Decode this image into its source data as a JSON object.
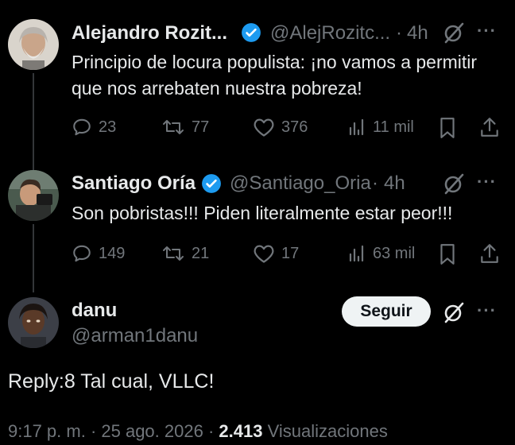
{
  "tweets": [
    {
      "name": "Alejandro Rozit...",
      "handle": "@AlejRozitc...",
      "time": "4h",
      "text": "Principio de locura populista: ¡no vamos a permitir que nos arrebaten nuestra pobreza!",
      "replies": "23",
      "retweets": "77",
      "likes": "376",
      "views": "11 mil"
    },
    {
      "name": "Santiago Oría",
      "handle": "@Santiago_Oria",
      "time": "4h",
      "text": "Son pobristas!!! Piden literalmente estar peor!!!",
      "replies": "149",
      "retweets": "21",
      "likes": "17",
      "views": "63 mil"
    }
  ],
  "main": {
    "name": "danu",
    "handle": "@arman1danu",
    "follow_label": "Seguir",
    "text": "Reply:8 Tal cual, VLLC!",
    "time_date": "9:17 p. m. · 25 ago. 2026 ·",
    "views_count": "2.413",
    "views_label": "Visualizaciones"
  },
  "separators": {
    "dot": "·",
    "more": "···"
  },
  "colors": {
    "background": "#000000",
    "text": "#e7e9ea",
    "muted": "#71767b",
    "verified": "#1d9bf0",
    "button": "#eff3f4"
  }
}
